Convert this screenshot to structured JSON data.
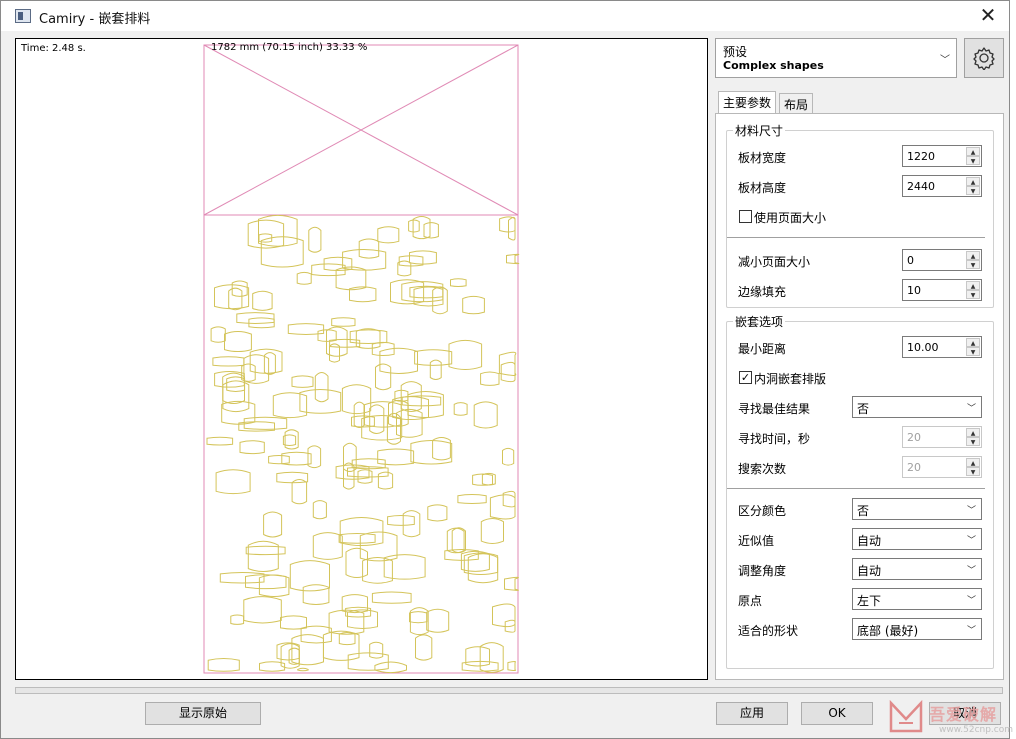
{
  "window": {
    "title": "Camiry - 嵌套排料"
  },
  "canvas": {
    "time_label": "Time: 2.48 s.",
    "sheet_label": "1782 mm (70.15 inch)  33.33 %"
  },
  "preset": {
    "label": "预设",
    "value": "Complex shapes"
  },
  "tabs": [
    {
      "label": "主要参数",
      "active": true
    },
    {
      "label": "布局",
      "active": false
    }
  ],
  "material": {
    "title": "材料尺寸",
    "width_label": "板材宽度",
    "width_value": "1220",
    "height_label": "板材高度",
    "height_value": "2440",
    "use_page_size_label": "使用页面大小",
    "use_page_size_checked": "",
    "reduce_page_label": "减小页面大小",
    "reduce_page_value": "0",
    "margin_label": "边缘填充",
    "margin_value": "10"
  },
  "nesting": {
    "title": "嵌套选项",
    "min_distance_label": "最小距离",
    "min_distance_value": "10.00",
    "inner_hole_label": "内洞嵌套排版",
    "inner_hole_checked": "✓",
    "find_best_label": "寻找最佳结果",
    "find_best_value": "否",
    "find_time_label": "寻找时间，秒",
    "find_time_value": "20",
    "search_count_label": "搜索次数",
    "search_count_value": "20",
    "color_label": "区分颜色",
    "color_value": "否",
    "approx_label": "近似值",
    "approx_value": "自动",
    "angle_label": "调整角度",
    "angle_value": "自动",
    "origin_label": "原点",
    "origin_value": "左下",
    "fit_shape_label": "适合的形状",
    "fit_shape_value": "底部 (最好)"
  },
  "buttons": {
    "show_original": "显示原始",
    "apply": "应用",
    "ok": "OK",
    "cancel": "取消"
  },
  "watermark": {
    "text": "吾爱破解",
    "url": "www.52cnp.com"
  },
  "colors": {
    "sheet_outline": "#e08ab5",
    "shapes": "#d4c45a"
  }
}
